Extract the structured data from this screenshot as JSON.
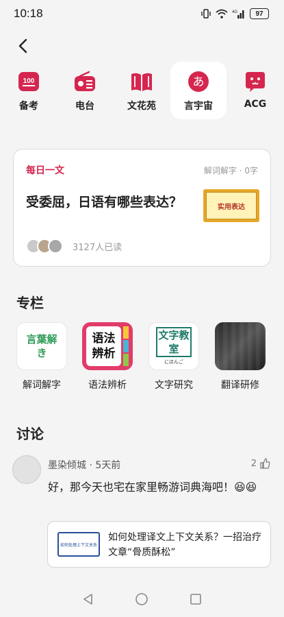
{
  "status_bar": {
    "time": "10:18",
    "battery": "97"
  },
  "nav": [
    {
      "label": "备考",
      "icon": "score-100-icon"
    },
    {
      "label": "电台",
      "icon": "radio-icon"
    },
    {
      "label": "文花苑",
      "icon": "book-icon"
    },
    {
      "label": "言宇宙",
      "icon": "hiragana-a-icon",
      "active": true
    },
    {
      "label": "ACG",
      "icon": "cat-icon"
    }
  ],
  "daily": {
    "tag": "每日一文",
    "meta": "解词解字 · 0字",
    "title": "受委屈，日语有哪些表达？",
    "thumb_text": "实用表达",
    "readers": "3127人已读"
  },
  "columns_section": {
    "title": "专栏",
    "items": [
      {
        "label": "解词解字",
        "tile_text": "言葉解き"
      },
      {
        "label": "语法辨析",
        "tile_text": "语法辨析"
      },
      {
        "label": "文字研究",
        "tile_text": "文字教室"
      },
      {
        "label": "翻译研修",
        "tile_text": ""
      }
    ],
    "tile_hint": "にほんご"
  },
  "discussion": {
    "title": "讨论",
    "user": "墨染倾城 · 5天前",
    "likes": "2",
    "text": "好，那今天也宅在家里畅游词典海吧！😆😆",
    "link_title": "如何处理译文上下文关系？一招治疗文章“骨质酥松”",
    "link_thumb_text": "如何处理上下文关系"
  },
  "colors": {
    "accent": "#d5264f",
    "background": "#f4f4f4"
  }
}
